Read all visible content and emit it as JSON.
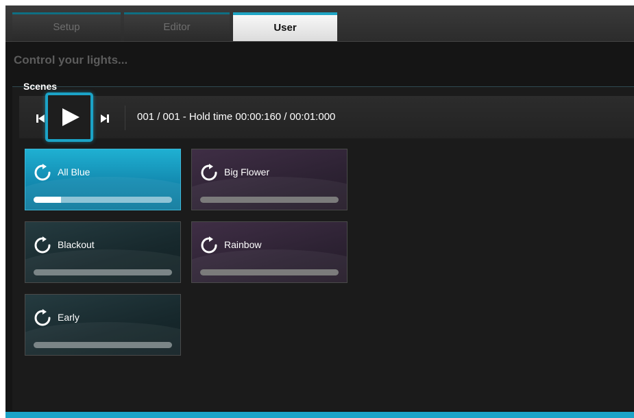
{
  "tabs": [
    {
      "label": "Setup",
      "active": false
    },
    {
      "label": "Editor",
      "active": false
    },
    {
      "label": "User",
      "active": true
    }
  ],
  "subtitle": "Control your lights...",
  "scenes_section": {
    "title": "Scenes",
    "status": "001 / 001 -  Hold time 00:00:160 / 00:01:000",
    "controls": {
      "prev_icon": "skip-previous-icon",
      "play_icon": "play-icon",
      "next_icon": "skip-next-icon"
    },
    "items": [
      {
        "label": "All Blue",
        "progress": 0.2,
        "style": "active",
        "icon": "loop-icon"
      },
      {
        "label": "Big Flower",
        "progress": 0,
        "style": "purple",
        "icon": "loop-icon"
      },
      {
        "label": "Blackout",
        "progress": 0,
        "style": "teal",
        "icon": "loop-icon"
      },
      {
        "label": "Rainbow",
        "progress": 0,
        "style": "purple",
        "icon": "loop-icon"
      },
      {
        "label": "Early",
        "progress": 0,
        "style": "teal",
        "icon": "loop-icon"
      }
    ]
  },
  "colors": {
    "accent": "#1ba3c7",
    "active_scene": "#1797bd",
    "teal_scene": "#1d3034",
    "purple_scene": "#34283a",
    "background": "#151515"
  }
}
